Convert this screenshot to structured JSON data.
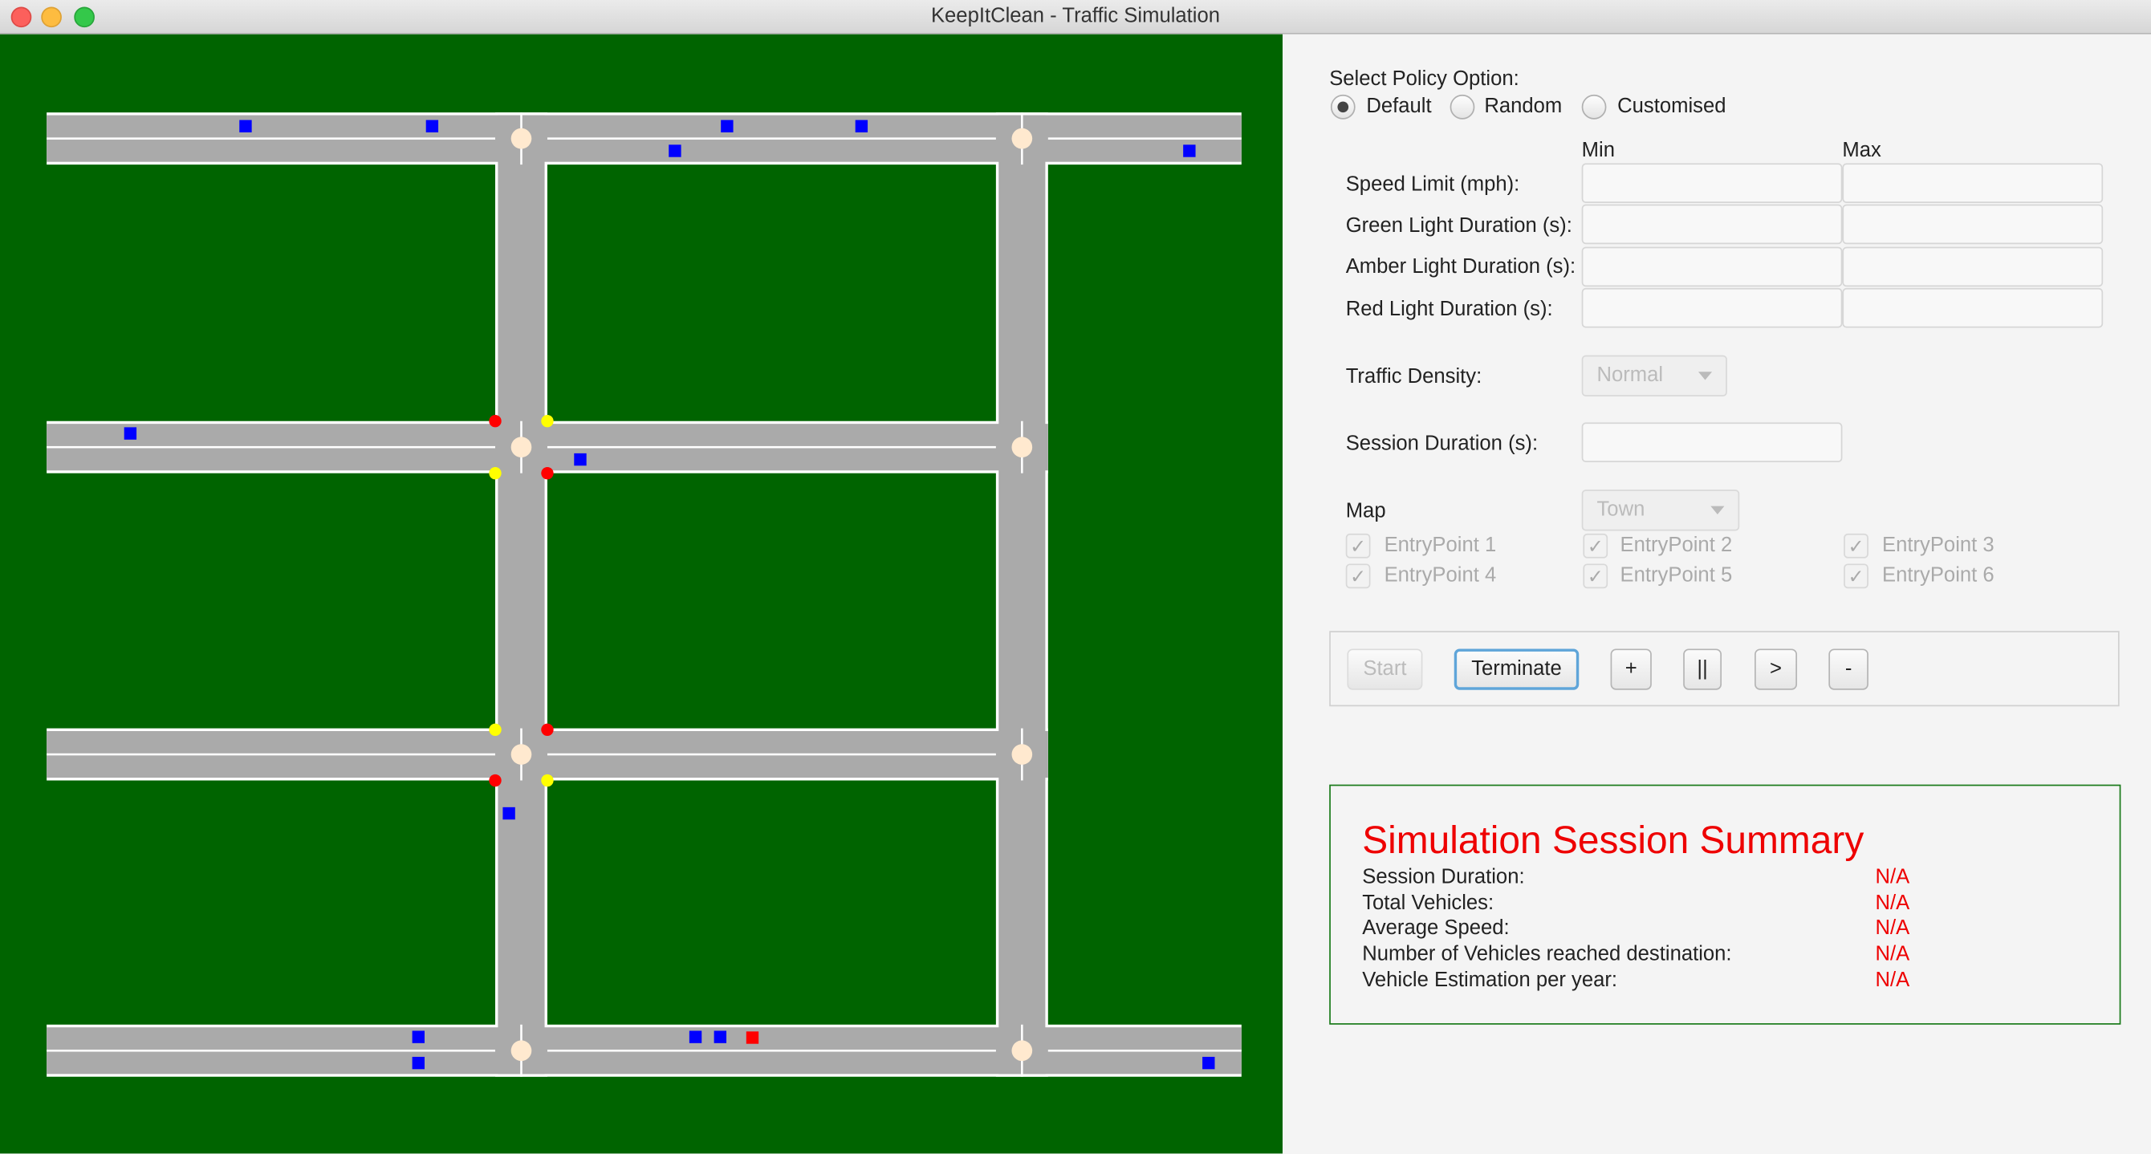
{
  "window": {
    "title": "KeepItClean - Traffic Simulation"
  },
  "policy": {
    "label": "Select Policy Option:",
    "options": [
      "Default",
      "Random",
      "Customised"
    ],
    "selected": "Default"
  },
  "params": {
    "min_header": "Min",
    "max_header": "Max",
    "rows": [
      {
        "label": "Speed Limit (mph):",
        "min": "",
        "max": ""
      },
      {
        "label": "Green Light Duration (s):",
        "min": "",
        "max": ""
      },
      {
        "label": "Amber Light Duration (s):",
        "min": "",
        "max": ""
      },
      {
        "label": "Red Light Duration (s):",
        "min": "",
        "max": ""
      }
    ]
  },
  "traffic_density": {
    "label": "Traffic Density:",
    "value": "Normal"
  },
  "session_duration": {
    "label": "Session Duration (s):",
    "value": ""
  },
  "map": {
    "label": "Map",
    "value": "Town",
    "entry_points": [
      {
        "label": "EntryPoint 1",
        "checked": true
      },
      {
        "label": "EntryPoint 2",
        "checked": true
      },
      {
        "label": "EntryPoint 3",
        "checked": true
      },
      {
        "label": "EntryPoint 4",
        "checked": true
      },
      {
        "label": "EntryPoint 5",
        "checked": true
      },
      {
        "label": "EntryPoint 6",
        "checked": true
      }
    ]
  },
  "controls": {
    "start": "Start",
    "terminate": "Terminate",
    "plus": "+",
    "pause": "||",
    "play": ">",
    "minus": "-"
  },
  "summary": {
    "title": "Simulation Session Summary",
    "rows": [
      {
        "label": "Session Duration:",
        "value": "N/A"
      },
      {
        "label": "Total Vehicles:",
        "value": "N/A"
      },
      {
        "label": "Average Speed:",
        "value": "N/A"
      },
      {
        "label": "Number of Vehicles reached destination:",
        "value": "N/A"
      },
      {
        "label": "Vehicle Estimation per year:",
        "value": "N/A"
      }
    ]
  },
  "colors": {
    "grass": "#006400",
    "road": "#aaaaaa",
    "vehicle": "#0000ff",
    "vehicle_alt": "#ff0000",
    "light_red": "#ff0000",
    "light_yellow": "#ffff00",
    "junction": "#ffe9cf",
    "summary_text": "#ee0000"
  }
}
